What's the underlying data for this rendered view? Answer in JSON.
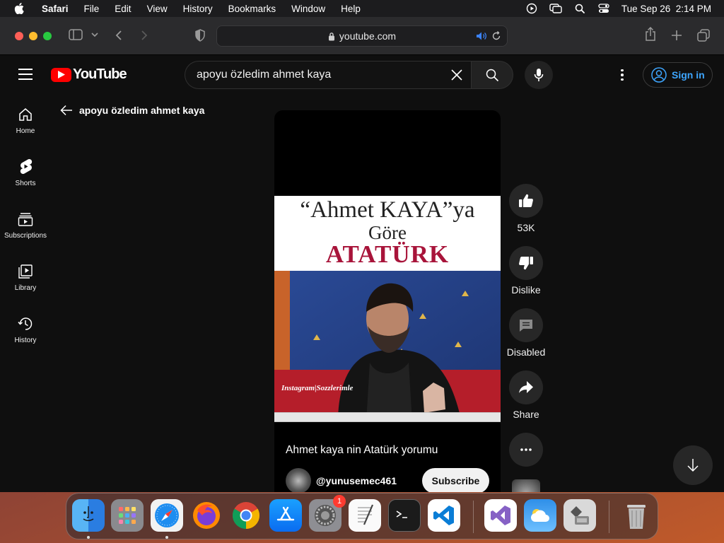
{
  "menubar": {
    "app_name": "Safari",
    "items": [
      "File",
      "Edit",
      "View",
      "History",
      "Bookmarks",
      "Window",
      "Help"
    ],
    "clock": "Tue Sep 26  2:14 PM"
  },
  "browser": {
    "url": "youtube.com"
  },
  "youtube": {
    "logo_text": "YouTube",
    "search_query": "apoyu özledim ahmet kaya",
    "sign_in_label": "Sign in",
    "nav": [
      {
        "label": "Home",
        "icon": "home-icon"
      },
      {
        "label": "Shorts",
        "icon": "shorts-icon"
      },
      {
        "label": "Subscriptions",
        "icon": "subscriptions-icon"
      },
      {
        "label": "Library",
        "icon": "library-icon"
      },
      {
        "label": "History",
        "icon": "history-icon"
      }
    ],
    "back_title": "apoyu özledim ahmet kaya",
    "short": {
      "thumb_line1": "“Ahmet KAYA”ya",
      "thumb_line2": "Göre",
      "thumb_line3": "ATATÜRK",
      "watermark": "Instagram|Sozzlerimle",
      "title": "Ahmet kaya nin Atatürk yorumu",
      "channel": "@yunusemec461",
      "subscribe_label": "Subscribe"
    },
    "actions": {
      "like_count": "53K",
      "dislike_label": "Dislike",
      "comments_label": "Disabled",
      "share_label": "Share"
    }
  },
  "dock": {
    "apps": [
      "Finder",
      "Launchpad",
      "Safari",
      "Firefox",
      "Chrome",
      "App Store",
      "System Settings",
      "TextEdit",
      "Terminal",
      "VS Code",
      "Visual Studio",
      "Weather",
      "Migration Assistant",
      "Trash"
    ],
    "settings_badge": "1"
  },
  "colors": {
    "yt_red": "#ff0000",
    "link_blue": "#3ea6ff",
    "thumb_title_red": "#a8143a"
  }
}
